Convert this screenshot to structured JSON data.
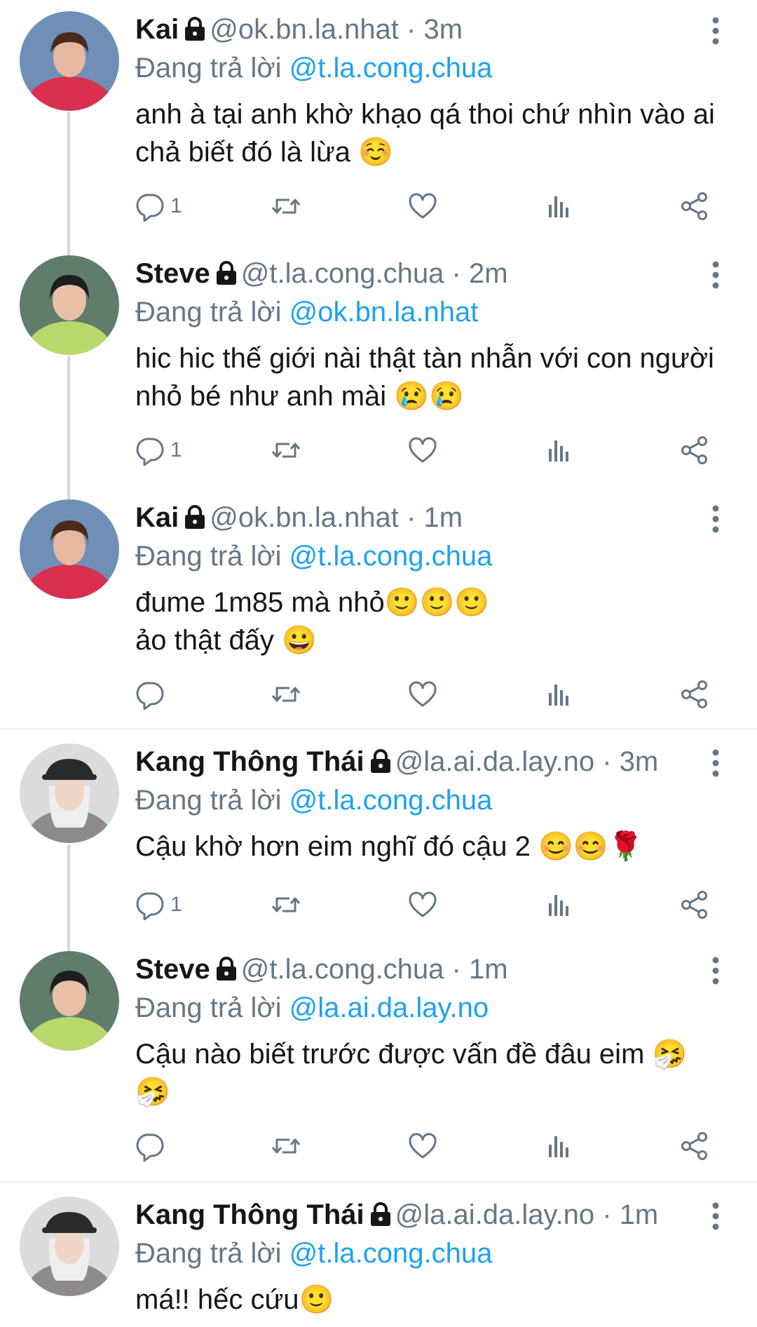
{
  "reply_prefix": "Đang trả lời",
  "tweets": [
    {
      "name": "Kai",
      "handle": "@ok.bn.la.nhat",
      "dot": "·",
      "time": "3m",
      "reply_to": "@t.la.cong.chua",
      "text": "anh à tại anh khờ khạo qá thoi chứ nhìn vào ai chả biết đó là lừa ☺️",
      "reply_count": "1"
    },
    {
      "name": "Steve",
      "handle": "@t.la.cong.chua",
      "dot": "·",
      "time": "2m",
      "reply_to": "@ok.bn.la.nhat",
      "text": "hic hic thế giới nài thật tàn nhẫn với con người nhỏ bé như anh mài 😢😢",
      "reply_count": "1"
    },
    {
      "name": "Kai",
      "handle": "@ok.bn.la.nhat",
      "dot": "·",
      "time": "1m",
      "reply_to": "@t.la.cong.chua",
      "text_line1": "đume 1m85 mà nhỏ🙂🙂🙂",
      "text_line2": "ảo thật đấy 😀",
      "reply_count": ""
    },
    {
      "name": "Kang Thông Thái",
      "handle": "@la.ai.da.lay.no",
      "dot": "·",
      "time": "3m",
      "reply_to": "@t.la.cong.chua",
      "text": "Cậu khờ hơn eim nghĩ đó cậu 2 😊😊🌹",
      "reply_count": "1"
    },
    {
      "name": "Steve",
      "handle": "@t.la.cong.chua",
      "dot": "·",
      "time": "1m",
      "reply_to": "@la.ai.da.lay.no",
      "text": "Cậu nào biết trước được vấn đề đâu eim 🤧🤧",
      "reply_count": ""
    },
    {
      "name": "Kang Thông Thái",
      "handle": "@la.ai.da.lay.no",
      "dot": "·",
      "time": "1m",
      "reply_to": "@t.la.cong.chua",
      "text": "má!! hếc cứu🙂"
    }
  ],
  "icons": {
    "lock": "lock-icon",
    "more": "more-vertical-icon",
    "reply": "reply-icon",
    "retweet": "retweet-icon",
    "like": "heart-icon",
    "analytics": "analytics-icon",
    "share": "share-icon"
  },
  "colors": {
    "mention": "#1da1f2",
    "secondary_text": "#657786",
    "thread_line": "#cfd9de",
    "icon": "#657786"
  }
}
